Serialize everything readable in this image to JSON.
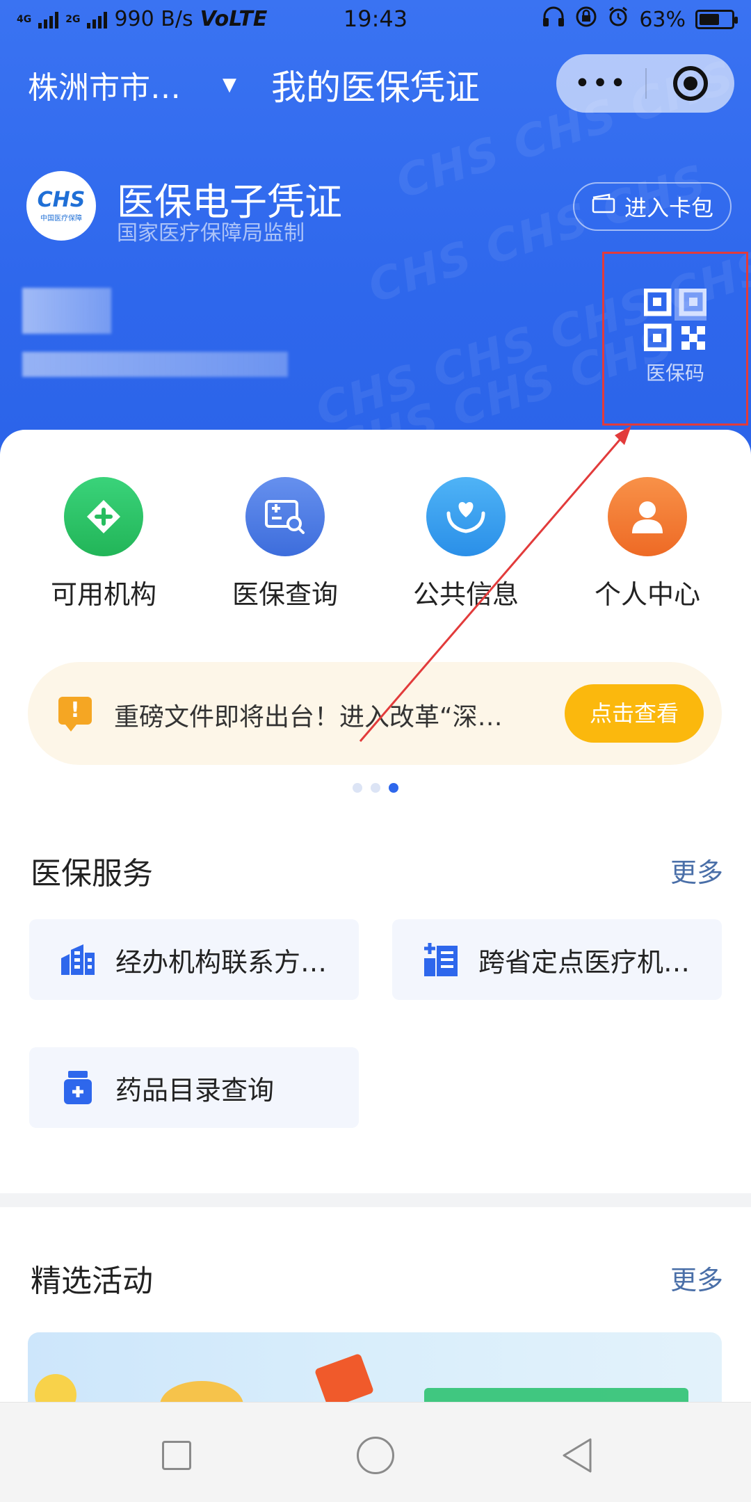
{
  "status_bar": {
    "network_left": "4G",
    "network_right": "2G",
    "speed": "990 B/s",
    "volte": "VoLTE",
    "time": "19:43",
    "battery": "63%",
    "battery_level": 0.63
  },
  "title_bar": {
    "city": "株洲市市…",
    "title": "我的医保凭证",
    "more_label": "•••"
  },
  "credential": {
    "logo_text": "CHS",
    "logo_subtext": "中国医疗保障",
    "title": "医保电子凭证",
    "subtitle": "国家医疗保障局监制",
    "wallet_button": "进入卡包",
    "qr_label": "医保码"
  },
  "quick_actions": [
    {
      "label": "可用机构",
      "icon": "plus-diamond-icon",
      "color": "#2cc464"
    },
    {
      "label": "医保查询",
      "icon": "card-search-icon",
      "color": "#4e7fe6"
    },
    {
      "label": "公共信息",
      "icon": "heart-hands-icon",
      "color": "#3aa0f0"
    },
    {
      "label": "个人中心",
      "icon": "person-icon",
      "color": "#f37a34"
    }
  ],
  "notice": {
    "text": "重磅文件即将出台！进入改革“深…",
    "button": "点击查看"
  },
  "carousel": {
    "count": 3,
    "active": 3
  },
  "services": {
    "title": "医保服务",
    "more": "更多",
    "items": [
      {
        "label": "经办机构联系方…",
        "icon": "building-icon"
      },
      {
        "label": "跨省定点医疗机…",
        "icon": "hospital-icon"
      },
      {
        "label": "药品目录查询",
        "icon": "medicine-bottle-icon"
      }
    ]
  },
  "activities": {
    "title": "精选活动",
    "more": "更多"
  },
  "colors": {
    "brand_blue": "#2e67ec",
    "notice_bg": "#fdf6e8",
    "cta_yellow": "#fbb80d",
    "highlight_red": "#e23b3b"
  }
}
